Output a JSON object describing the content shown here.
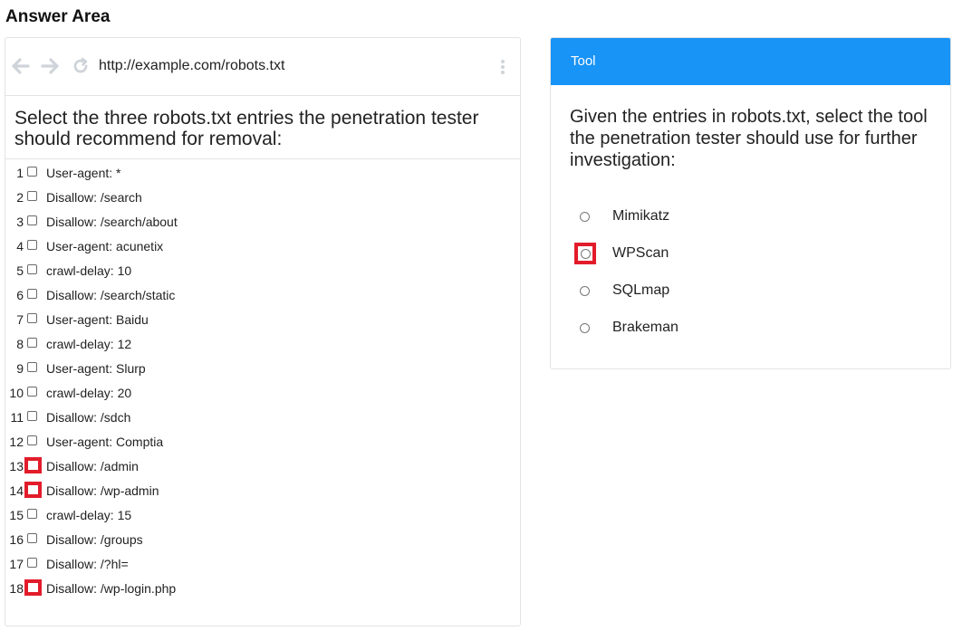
{
  "page_title": "Answer Area",
  "browser": {
    "url": "http://example.com/robots.txt",
    "icons": {
      "back": "arrow-left-icon",
      "forward": "arrow-right-icon",
      "refresh": "refresh-icon",
      "menu": "kebab-menu-icon"
    },
    "instructions": "Select the three robots.txt entries the penetration tester should recommend for removal:",
    "entries": [
      {
        "num": "1",
        "text": "User-agent: *",
        "highlighted": false
      },
      {
        "num": "2",
        "text": "Disallow: /search",
        "highlighted": false
      },
      {
        "num": "3",
        "text": "Disallow: /search/about",
        "highlighted": false
      },
      {
        "num": "4",
        "text": "User-agent: acunetix",
        "highlighted": false
      },
      {
        "num": "5",
        "text": "crawl-delay: 10",
        "highlighted": false
      },
      {
        "num": "6",
        "text": "Disallow: /search/static",
        "highlighted": false
      },
      {
        "num": "7",
        "text": "User-agent: Baidu",
        "highlighted": false
      },
      {
        "num": "8",
        "text": "crawl-delay: 12",
        "highlighted": false
      },
      {
        "num": "9",
        "text": "User-agent: Slurp",
        "highlighted": false
      },
      {
        "num": "10",
        "text": "crawl-delay: 20",
        "highlighted": false
      },
      {
        "num": "11",
        "text": "Disallow: /sdch",
        "highlighted": false
      },
      {
        "num": "12",
        "text": "User-agent: Comptia",
        "highlighted": false
      },
      {
        "num": "13",
        "text": "Disallow: /admin",
        "highlighted": true
      },
      {
        "num": "14",
        "text": "Disallow: /wp-admin",
        "highlighted": true
      },
      {
        "num": "15",
        "text": "crawl-delay: 15",
        "highlighted": false
      },
      {
        "num": "16",
        "text": "Disallow: /groups",
        "highlighted": false
      },
      {
        "num": "17",
        "text": "Disallow: /?hl=",
        "highlighted": false
      },
      {
        "num": "18",
        "text": "Disallow: /wp-login.php",
        "highlighted": true
      }
    ]
  },
  "tool_panel": {
    "header": "Tool",
    "question": "Given the entries in robots.txt, select the tool the penetration tester should use for further investigation:",
    "options": [
      {
        "label": "Mimikatz",
        "highlighted": false
      },
      {
        "label": "WPScan",
        "highlighted": true
      },
      {
        "label": "SQLmap",
        "highlighted": false
      },
      {
        "label": "Brakeman",
        "highlighted": false
      }
    ]
  },
  "colors": {
    "header_blue": "#1893f6",
    "highlight_red": "#e21c2a",
    "nav_icon_gray": "#cfd4da"
  }
}
